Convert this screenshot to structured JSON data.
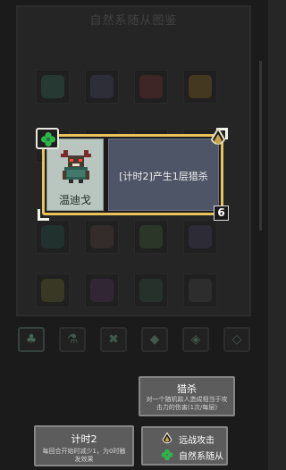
{
  "background": {
    "title": "自然系随从图鉴",
    "grid_rows": [
      [
        "#3f6b5c",
        "#52506a",
        "#7a3d3d",
        "#8a6a2f"
      ],
      [
        "#3a5c50",
        "#4c4c66",
        "#6e4343",
        "#5b5b3a"
      ],
      [
        "#2f5a52",
        "#604848",
        "#4d6442",
        "#4f4a66"
      ],
      [
        "#6a6a3a",
        "#5a3f5f",
        "#3f5a4a",
        "#4f4f4f"
      ]
    ],
    "tabs": [
      "♣",
      "⚗",
      "✖",
      "◆",
      "◈",
      "◇"
    ]
  },
  "card": {
    "name": "温迪戈",
    "description": "[计时2]产生1层猎杀",
    "cost": "6",
    "border_color": "#e9c25a"
  },
  "tooltips": {
    "hunt": {
      "title": "猎杀",
      "body": "对一个随机敌人造成相当于攻击力的伤害(1次/每层)"
    },
    "timer": {
      "title": "计时2",
      "body": "每回合开始时减少1，为0时触发效果"
    },
    "tags": {
      "combat": "远战攻击",
      "nature": "自然系随从"
    }
  },
  "icons": {
    "clover": "clover-icon",
    "drop": "drop-icon",
    "wendigo": "wendigo-sprite-icon"
  }
}
